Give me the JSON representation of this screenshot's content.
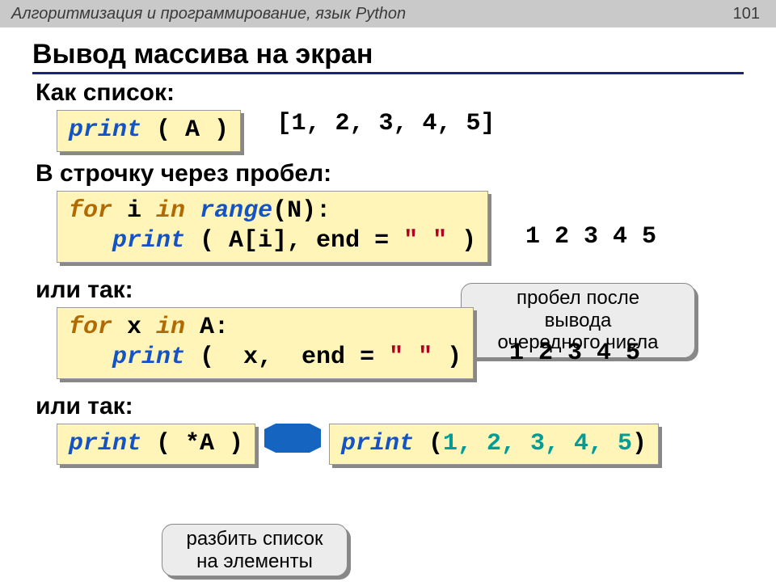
{
  "header": {
    "course": "Алгоритмизация и программирование, язык Python",
    "page": "101"
  },
  "section_title": "Вывод массива на экран",
  "block1": {
    "label": "Как список:",
    "print_kw": "print",
    "print_rest": " ( A )",
    "output": "[1, 2, 3, 4, 5]"
  },
  "block2": {
    "label": "В строчку через пробел:",
    "l1_for": "for",
    "l1_a": " i ",
    "l1_in": "in",
    "l1_b": " ",
    "l1_range": "range",
    "l1_c": "(N):",
    "l2_indent": "   ",
    "l2_print": "print",
    "l2_a": " ( A[i], end = ",
    "l2_str": "\" \"",
    "l2_b": " )",
    "output": "1 2 3 4 5",
    "callout": "пробел после\nвывода\nочередного числа"
  },
  "block3": {
    "label": "или так:",
    "l1_for": "for",
    "l1_a": " x ",
    "l1_in": "in",
    "l1_b": " A:",
    "l2_indent": "   ",
    "l2_print": "print",
    "l2_a": " (  x,  end = ",
    "l2_str": "\" \"",
    "l2_b": " )",
    "output": "1 2 3 4 5"
  },
  "block4": {
    "label": "или так:",
    "left_print": "print",
    "left_rest": " ( *A )",
    "right_print": "print",
    "right_a": " (",
    "right_nums": "1, 2, 3, 4, 5",
    "right_b": ")",
    "callout": "разбить список\nна элементы"
  }
}
